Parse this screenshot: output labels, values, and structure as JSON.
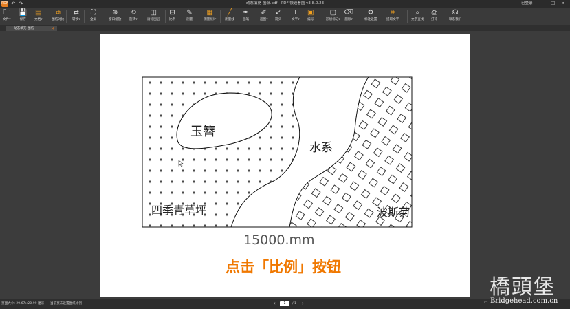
{
  "window": {
    "title": "动态填充-图纸.pdf - PDF 快速看图 v3.8.0.23",
    "logo_text": "PDF",
    "undo_icon": "↶",
    "redo_icon": "↷",
    "login": "已登录"
  },
  "toolbar": [
    {
      "name": "file",
      "label": "文件▾",
      "icon": "folder-icon",
      "glyph": "🗀"
    },
    {
      "name": "save",
      "label": "保存",
      "icon": "save-icon",
      "glyph": "💾"
    },
    {
      "name": "doc",
      "label": "文档▾",
      "icon": "document-icon",
      "glyph": "▤",
      "orange": true
    },
    {
      "name": "compare",
      "label": "图纸对比",
      "icon": "compare-icon",
      "glyph": "⧉",
      "orange": true
    },
    {
      "name": "convert",
      "label": "转换▾",
      "icon": "convert-icon",
      "glyph": "⇄"
    },
    {
      "name": "fullscreen",
      "label": "全屏",
      "icon": "fullscreen-icon",
      "glyph": "⛶"
    },
    {
      "name": "window-zoom",
      "label": "窗口缩放",
      "icon": "zoom-icon",
      "glyph": "⊕"
    },
    {
      "name": "rotate",
      "label": "旋转▾",
      "icon": "rotate-icon",
      "glyph": "⟲"
    },
    {
      "name": "erase-content",
      "label": "清除图层",
      "icon": "layer-icon",
      "glyph": "◫"
    },
    {
      "name": "scale",
      "label": "比例",
      "icon": "scale-icon",
      "glyph": "⊟"
    },
    {
      "name": "measure",
      "label": "测量",
      "icon": "measure-icon",
      "glyph": "✎"
    },
    {
      "name": "measure-stats",
      "label": "测量统计",
      "icon": "stats-icon",
      "glyph": "▦",
      "orange": true
    },
    {
      "name": "line",
      "label": "测量线",
      "icon": "line-icon",
      "glyph": "╱",
      "orange": true
    },
    {
      "name": "pen",
      "label": "画笔",
      "icon": "pen-icon",
      "glyph": "✒"
    },
    {
      "name": "shape",
      "label": "画图▾",
      "icon": "brush-icon",
      "glyph": "✐"
    },
    {
      "name": "arrow",
      "label": "箭头",
      "icon": "arrow-icon",
      "glyph": "↙"
    },
    {
      "name": "text",
      "label": "文字▾",
      "icon": "text-icon",
      "glyph": "T"
    },
    {
      "name": "number",
      "label": "编号",
      "icon": "number-icon",
      "glyph": "▣",
      "orange": true
    },
    {
      "name": "shape-mark",
      "label": "形状标记▾",
      "icon": "shape-icon",
      "glyph": "▢"
    },
    {
      "name": "delete",
      "label": "删除▾",
      "icon": "eraser-icon",
      "glyph": "⌫"
    },
    {
      "name": "mark-settings",
      "label": "标注设置",
      "icon": "settings-icon",
      "glyph": "⚙"
    },
    {
      "name": "extract-text",
      "label": "提取文字",
      "icon": "extract-icon",
      "glyph": "⌗",
      "orange": true
    },
    {
      "name": "text-search",
      "label": "文字查找",
      "icon": "search-icon",
      "glyph": "⌕"
    },
    {
      "name": "print",
      "label": "打印",
      "icon": "print-icon",
      "glyph": "⎙"
    },
    {
      "name": "contact",
      "label": "联系我们",
      "icon": "headset-icon",
      "glyph": "☊"
    }
  ],
  "tab": {
    "label": "动态填充-图纸",
    "close": "✕"
  },
  "drawing": {
    "label_jade": "玉簪",
    "label_water": "水系",
    "label_grass": "四季青草坪",
    "label_persian": "波斯菊",
    "dimension": "15000.mm",
    "caption": "点击「比例」按钮",
    "caption_color": "#f07800"
  },
  "status": {
    "page_size": "页面大小: 29.67×20.99 厘米",
    "scale_hint": "当前页未设置图纸比例",
    "prev": "‹",
    "current_page": "1",
    "total": "/ 1",
    "next": "›"
  },
  "watermark": {
    "cn": "橋頭堡",
    "url": "Bridgehead.com.cn"
  }
}
